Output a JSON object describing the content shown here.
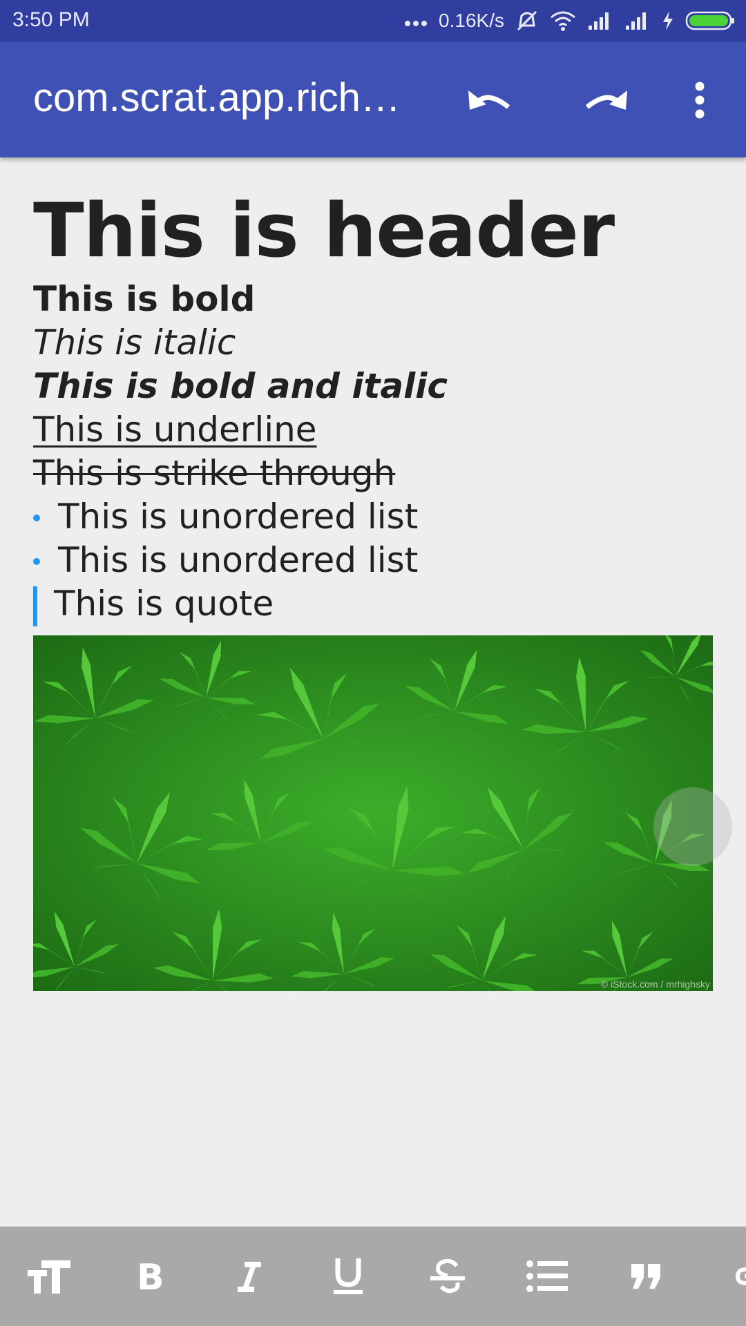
{
  "status_bar": {
    "time": "3:50 PM",
    "net_speed": "0.16K/s",
    "icons": [
      "more-dots-icon",
      "vibrate-off-icon",
      "wifi-icon",
      "signal-icon",
      "signal-icon",
      "charging-icon",
      "battery-icon"
    ]
  },
  "app_bar": {
    "title": "com.scrat.app.rich…",
    "actions": [
      "undo-icon",
      "redo-icon",
      "more-vert-icon"
    ]
  },
  "editor": {
    "header": "This is header",
    "bold": "This is bold",
    "italic": "This is italic",
    "bold_italic": "This is bold and italic",
    "underline": "This is underline",
    "strike": "This is strike through",
    "list_items": [
      "This is unordered list",
      "This is unordered list"
    ],
    "quote": "This is quote",
    "image_watermark": "© iStock.com / mrhighsky"
  },
  "format_toolbar": {
    "tools": [
      "text-size-icon",
      "bold-icon",
      "italic-icon",
      "underline-icon",
      "strikethrough-icon",
      "bulleted-list-icon",
      "quote-icon",
      "link-icon"
    ]
  },
  "colors": {
    "status_bar": "#303f9f",
    "app_bar": "#3f51b5",
    "accent": "#2196f3",
    "toolbar": "#a9a9a9"
  }
}
